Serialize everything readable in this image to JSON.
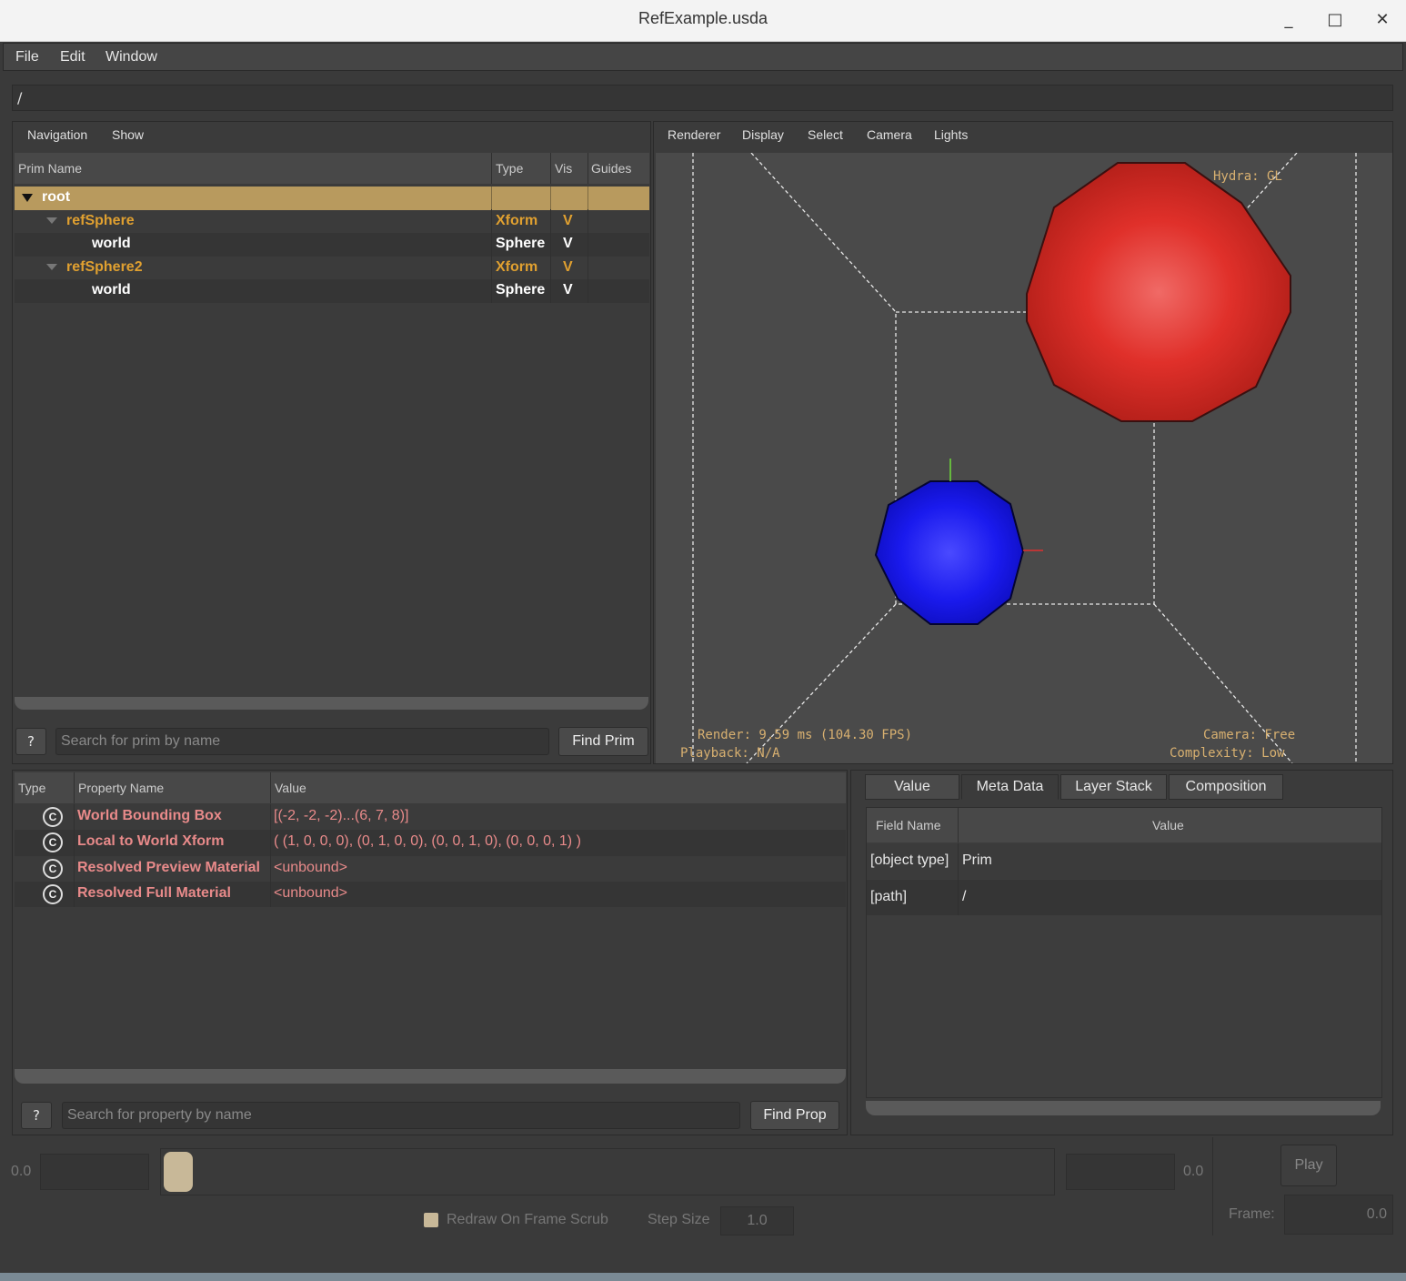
{
  "window": {
    "title": "RefExample.usda",
    "minimize": "_",
    "maximize": "□",
    "close": "✕"
  },
  "menubar": {
    "items": [
      "File",
      "Edit",
      "Window"
    ]
  },
  "path": "/",
  "prim_panel": {
    "menus": [
      "Navigation",
      "Show"
    ],
    "columns": [
      "Prim Name",
      "Type",
      "Vis",
      "Guides"
    ],
    "rows": [
      {
        "name": "root",
        "type": "",
        "vis": ""
      },
      {
        "name": "refSphere",
        "type": "Xform",
        "vis": "V"
      },
      {
        "name": "world",
        "type": "Sphere",
        "vis": "V"
      },
      {
        "name": "refSphere2",
        "type": "Xform",
        "vis": "V"
      },
      {
        "name": "world",
        "type": "Sphere",
        "vis": "V"
      }
    ],
    "help_button": "?",
    "search_placeholder": "Search for prim by name",
    "find_button": "Find Prim"
  },
  "viewport": {
    "menus": [
      "Renderer",
      "Display",
      "Select",
      "Camera",
      "Lights"
    ],
    "renderer": "Hydra: GL",
    "render_stats": "Render: 9.59 ms (104.30 FPS)",
    "playback": "Playback: N/A",
    "camera": "Camera: Free",
    "complexity": "Complexity: Low",
    "colors": {
      "red_sphere": "#e0302a",
      "blue_sphere": "#1a1aee",
      "background": "#4a4a4a"
    }
  },
  "property_panel": {
    "columns": [
      "Type",
      "Property Name",
      "Value"
    ],
    "type_icon": "C",
    "rows": [
      {
        "name": "World Bounding Box",
        "value": "[(-2, -2, -2)...(6, 7, 8)]"
      },
      {
        "name": "Local to World Xform",
        "value": "( (1, 0, 0, 0), (0, 1, 0, 0), (0, 0, 1, 0), (0, 0, 0, 1) )"
      },
      {
        "name": "Resolved Preview Material",
        "value": "<unbound>"
      },
      {
        "name": "Resolved Full Material",
        "value": "<unbound>"
      }
    ],
    "help_button": "?",
    "search_placeholder": "Search for property by name",
    "find_button": "Find Prop"
  },
  "meta_panel": {
    "tabs": [
      "Value",
      "Meta Data",
      "Layer Stack",
      "Composition"
    ],
    "active_tab": "Meta Data",
    "columns": [
      "Field Name",
      "Value"
    ],
    "rows": [
      {
        "field": "[object type]",
        "value": "Prim"
      },
      {
        "field": "[path]",
        "value": "/"
      }
    ]
  },
  "timeline": {
    "start": "0.0",
    "end": "0.0",
    "play_button": "Play",
    "redraw_label": "Redraw On Frame Scrub",
    "step_size_label": "Step Size",
    "step_size": "1.0",
    "frame_label": "Frame:",
    "frame_value": "0.0"
  }
}
